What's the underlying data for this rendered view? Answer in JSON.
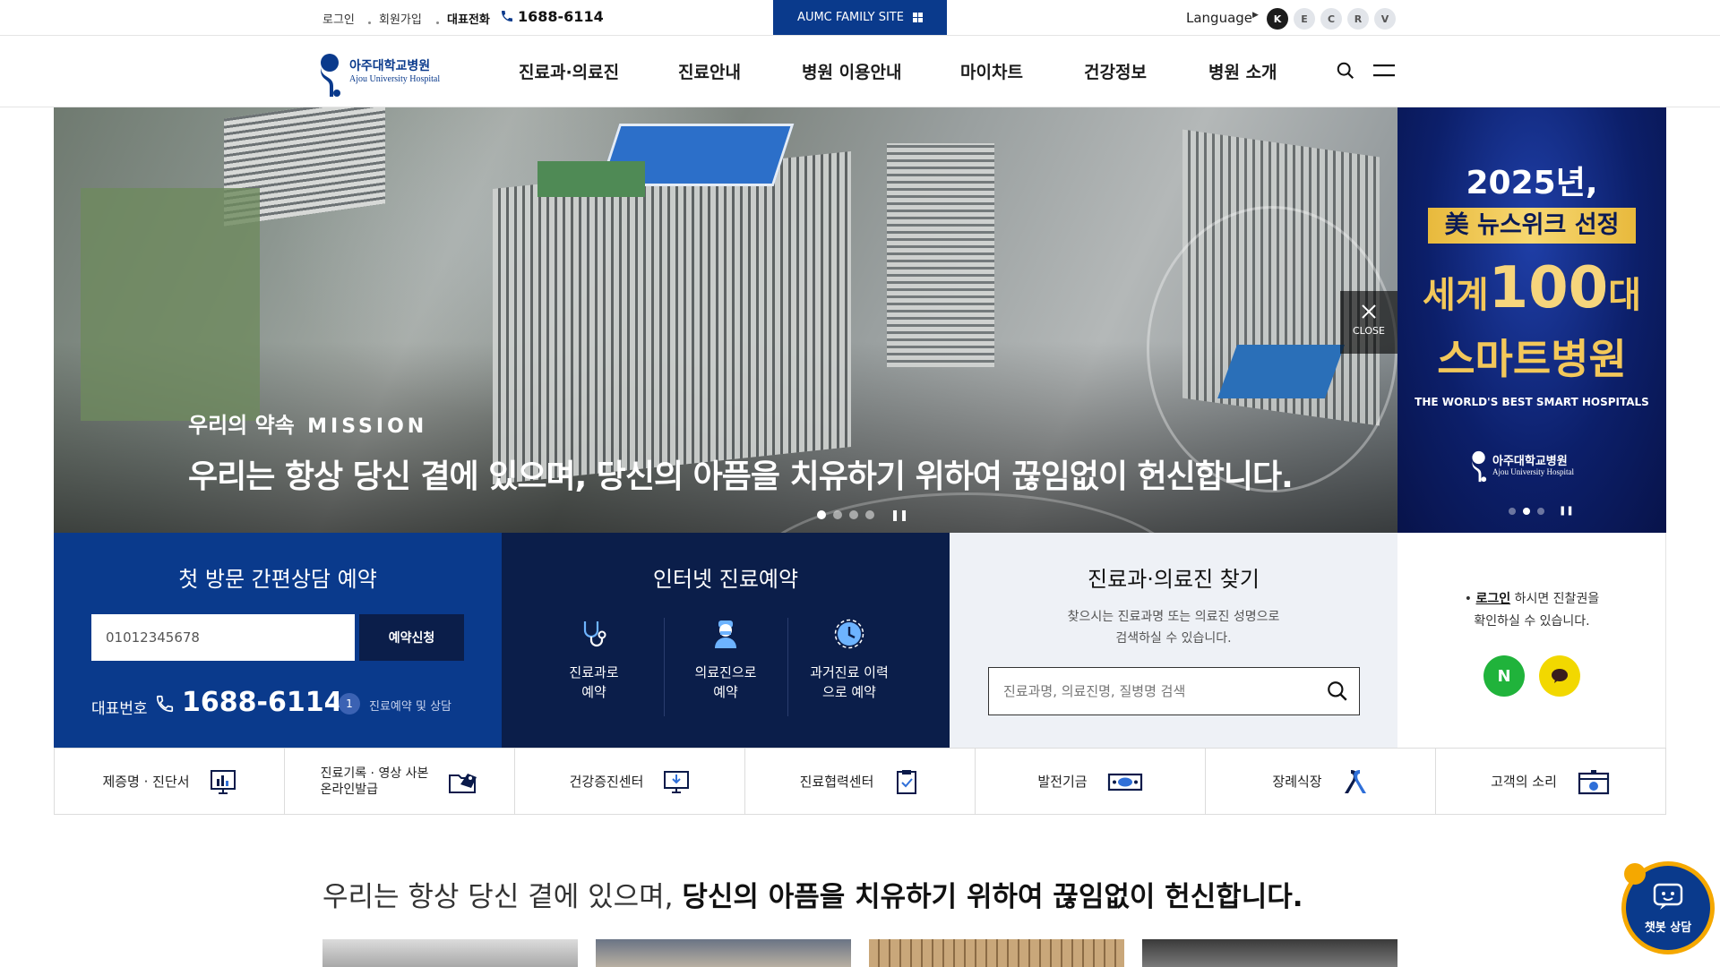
{
  "topbar": {
    "login": "로그인",
    "signup": "회원가입",
    "phone_label": "대표전화",
    "phone_number": "1688-6114",
    "family_site": "AUMC FAMILY SITE",
    "language_label": "Language",
    "languages": [
      "K",
      "E",
      "C",
      "R",
      "V"
    ]
  },
  "header": {
    "logo_ko": "아주대학교병원",
    "logo_en": "Ajou University Hospital",
    "nav": [
      "진료과·의료진",
      "진료안내",
      "병원 이용안내",
      "마이차트",
      "건강정보",
      "병원 소개"
    ]
  },
  "hero": {
    "label_ko": "우리의 약속",
    "label_en": "MISSION",
    "headline": "우리는 항상 당신 곁에 있으며, 당신의 아픔을 치유하기 위하여 끊임없이 헌신합니다.",
    "close_label": "CLOSE",
    "slides_total": 4,
    "slide_active": 1
  },
  "banner": {
    "line1": "2025년,",
    "line2": "美 뉴스위크 선정",
    "line3_a": "세계",
    "line3_num": "100",
    "line3_b": "대",
    "line4": "스마트병원",
    "line5": "THE WORLD'S BEST SMART HOSPITALS",
    "logo_ko": "아주대학교병원",
    "logo_en": "Ajou University Hospital",
    "slides_total": 3,
    "slide_active": 2
  },
  "panel_consult": {
    "title": "첫 방문 간편상담 예약",
    "phone_value": "01012345678",
    "submit": "예약신청",
    "rep_label": "대표번호",
    "rep_number": "1688-6114",
    "option_num": "1",
    "option_text": "진료예약 및 상담"
  },
  "panel_reserve": {
    "title": "인터넷 진료예약",
    "items": [
      {
        "label": "진료과로\n예약",
        "icon": "stethoscope-icon"
      },
      {
        "label": "의료진으로\n예약",
        "icon": "doctor-icon"
      },
      {
        "label": "과거진료 이력\n으로 예약",
        "icon": "history-clock-icon"
      }
    ]
  },
  "panel_search": {
    "title": "진료과·의료진 찾기",
    "desc1": "찾으시는 진료과명 또는 의료진 성명으로",
    "desc2": "검색하실 수 있습니다.",
    "placeholder": "진료과명, 의료진명, 질병명 검색"
  },
  "panel_login": {
    "bullet": "•",
    "login_link": "로그인",
    "text1": " 하시면 진찰권을",
    "text2": "확인하실 수 있습니다.",
    "naver": "N"
  },
  "quick_menu": [
    {
      "label": "제증명 · 진단서",
      "icon": "chart-board-icon"
    },
    {
      "label": "진료기록 · 영상 사본\n온라인발급",
      "icon": "folder-image-icon"
    },
    {
      "label": "건강증진센터",
      "icon": "monitor-download-icon"
    },
    {
      "label": "진료협력센터",
      "icon": "clipboard-icon"
    },
    {
      "label": "발전기금",
      "icon": "money-icon"
    },
    {
      "label": "장례식장",
      "icon": "ribbon-icon"
    },
    {
      "label": "고객의 소리",
      "icon": "mailbox-icon"
    }
  ],
  "mission_statement": {
    "light": "우리는 항상 당신 곁에 있으며, ",
    "bold": "당신의 아픔을 치유하기 위하여 끊임없이 헌신합니다."
  },
  "chatbot": {
    "label": "챗봇 상담"
  },
  "colors": {
    "brand_blue": "#0a3a8c",
    "navy": "#0b1e4a",
    "search_bg": "#eef1f6",
    "naver_green": "#20b33b",
    "kakao_yellow": "#f2d800",
    "badge_orange": "#f5a800"
  }
}
